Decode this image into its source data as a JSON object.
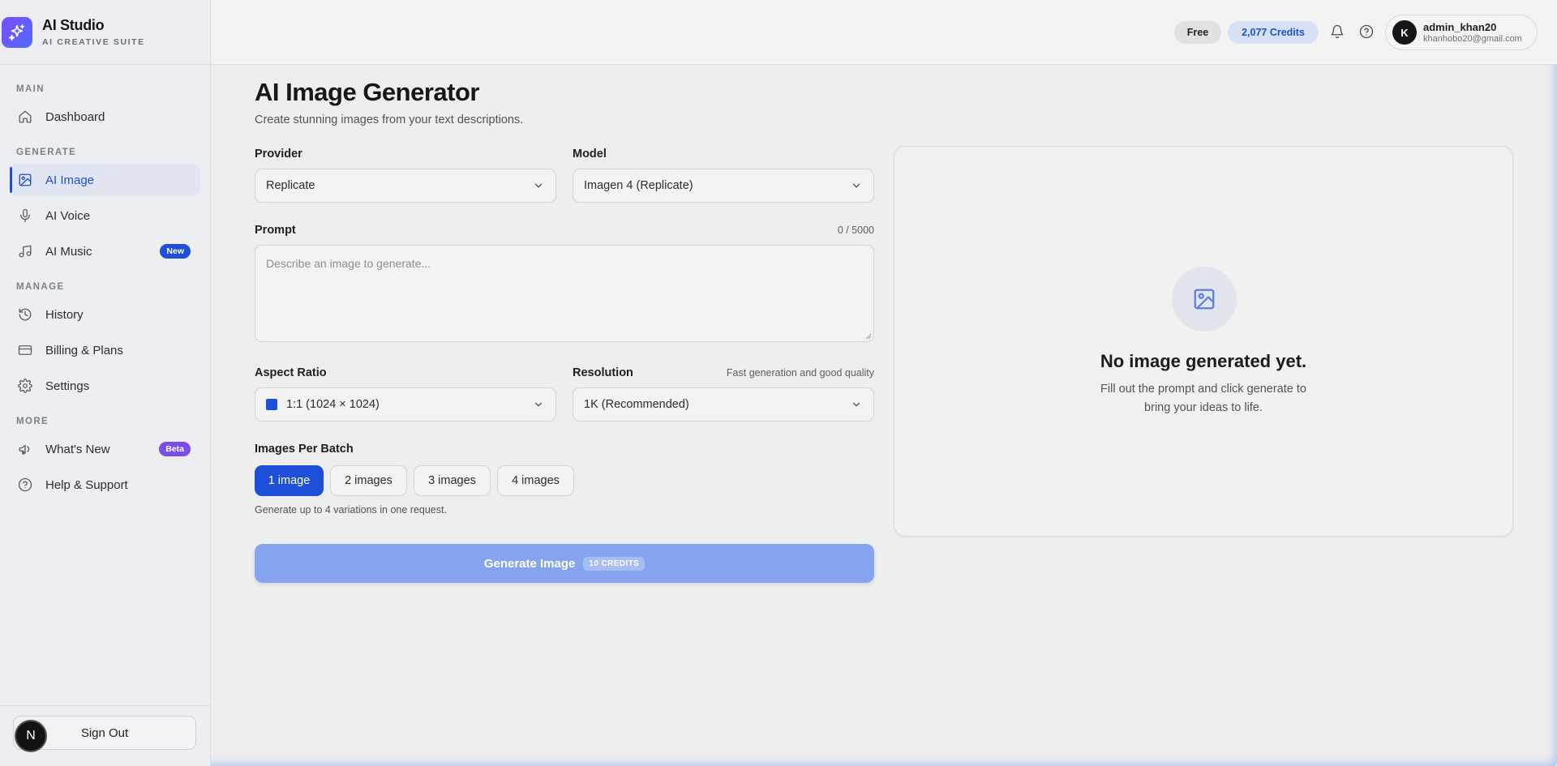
{
  "brand": {
    "title": "AI Studio",
    "subtitle": "AI CREATIVE SUITE"
  },
  "sidebar": {
    "sections": [
      {
        "label": "MAIN",
        "items": [
          {
            "label": "Dashboard",
            "icon": "home-icon"
          }
        ]
      },
      {
        "label": "GENERATE",
        "items": [
          {
            "label": "AI Image",
            "icon": "image-icon",
            "active": true
          },
          {
            "label": "AI Voice",
            "icon": "microphone-icon"
          },
          {
            "label": "AI Music",
            "icon": "music-note-icon",
            "badge": "New"
          }
        ]
      },
      {
        "label": "MANAGE",
        "items": [
          {
            "label": "History",
            "icon": "history-icon"
          },
          {
            "label": "Billing & Plans",
            "icon": "credit-card-icon"
          },
          {
            "label": "Settings",
            "icon": "gear-icon"
          }
        ]
      },
      {
        "label": "MORE",
        "items": [
          {
            "label": "What's New",
            "icon": "megaphone-icon",
            "badge": "Beta"
          },
          {
            "label": "Help & Support",
            "icon": "help-circle-icon"
          }
        ]
      }
    ],
    "signout_label": "Sign Out",
    "floating_avatar": "N"
  },
  "header": {
    "plan": "Free",
    "credits": "2,077 Credits",
    "user": {
      "initial": "K",
      "name": "admin_khan20",
      "email": "khanhobo20@gmail.com"
    }
  },
  "main": {
    "title": "AI Image Generator",
    "subtitle": "Create stunning images from your text descriptions.",
    "provider": {
      "label": "Provider",
      "value": "Replicate"
    },
    "model": {
      "label": "Model",
      "value": "Imagen 4 (Replicate)"
    },
    "prompt": {
      "label": "Prompt",
      "counter": "0 / 5000",
      "placeholder": "Describe an image to generate..."
    },
    "aspect_ratio": {
      "label": "Aspect Ratio",
      "value": "1:1 (1024 × 1024)"
    },
    "resolution": {
      "label": "Resolution",
      "hint": "Fast generation and good quality",
      "value": "1K (Recommended)"
    },
    "batch": {
      "label": "Images Per Batch",
      "options": [
        "1 image",
        "2 images",
        "3 images",
        "4 images"
      ],
      "selected_index": 0,
      "hint": "Generate up to 4 variations in one request."
    },
    "generate": {
      "label": "Generate Image",
      "cost": "10 CREDITS"
    }
  },
  "preview": {
    "icon": "image-icon",
    "title": "No image generated yet.",
    "desc_line1": "Fill out the prompt and click generate to",
    "desc_line2": "bring your ideas to life."
  },
  "colors": {
    "accent": "#1d4fd8",
    "beta": "#7b4ce6",
    "generate_disabled": "#85a3ef"
  }
}
